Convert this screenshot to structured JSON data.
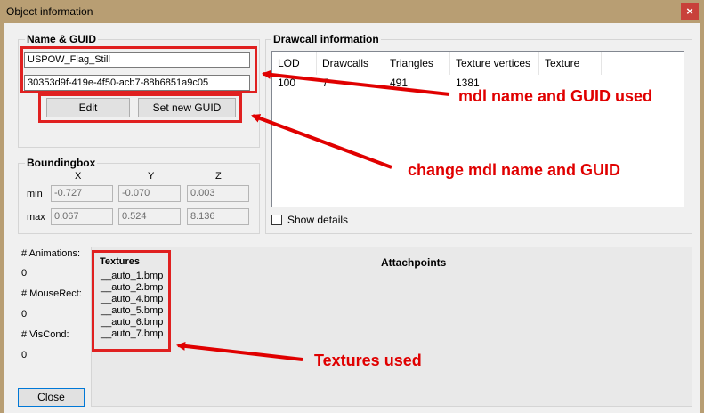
{
  "window": {
    "title": "Object information",
    "close_glyph": "×"
  },
  "name_guid": {
    "title": "Name & GUID",
    "name_value": "USPOW_Flag_Still",
    "guid_value": "30353d9f-419e-4f50-acb7-88b6851a9c05",
    "edit_label": "Edit",
    "set_guid_label": "Set new GUID"
  },
  "boundingbox": {
    "title": "Boundingbox",
    "cols": [
      "X",
      "Y",
      "Z"
    ],
    "min_label": "min",
    "max_label": "max",
    "min": [
      "-0.727",
      "-0.070",
      "0.003"
    ],
    "max": [
      "0.067",
      "0.524",
      "8.136"
    ]
  },
  "drawcall": {
    "title": "Drawcall information",
    "headers": [
      "LOD",
      "Drawcalls",
      "Triangles",
      "Texture vertices",
      "Texture"
    ],
    "row": [
      "100",
      "7",
      "491",
      "1381",
      ""
    ],
    "show_details": "Show details"
  },
  "stats": {
    "animations_label": "# Animations:",
    "animations_value": "0",
    "mouserect_label": "# MouseRect:",
    "mouserect_value": "0",
    "viscond_label": "# VisCond:",
    "viscond_value": "0"
  },
  "textures": {
    "title": "Textures",
    "items": [
      "__auto_1.bmp",
      "__auto_2.bmp",
      "__auto_4.bmp",
      "__auto_5.bmp",
      "__auto_6.bmp",
      "__auto_7.bmp"
    ]
  },
  "attachpoints": {
    "title": "Attachpoints"
  },
  "close_button": {
    "label": "Close"
  },
  "annotations": {
    "mdl_name_guid": "mdl name and GUID used",
    "change": "change mdl name and GUID",
    "textures_used": "Textures used"
  },
  "colors": {
    "annotation": "#e00000",
    "titlebar": "#b89e73",
    "close": "#c8413a"
  }
}
